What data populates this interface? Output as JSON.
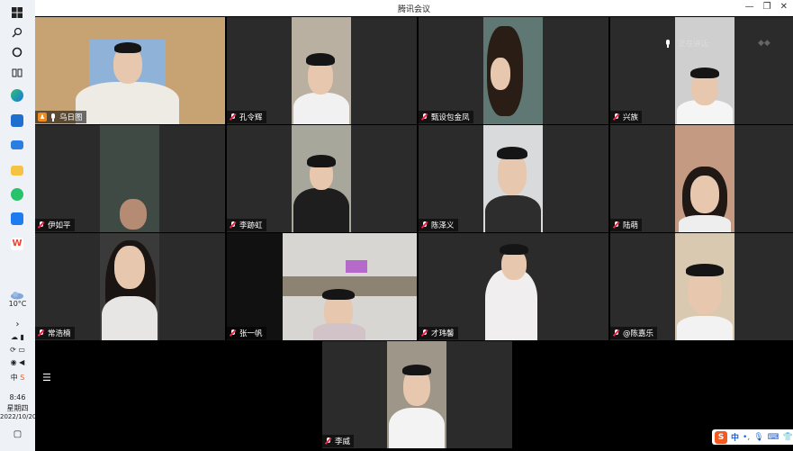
{
  "window": {
    "title": "腾讯会议"
  },
  "taskbar": {
    "weather": "10°C",
    "time": "8:46",
    "weekday": "星期四",
    "date": "2022/10/20"
  },
  "participants": [
    {
      "name": "乌日图",
      "mic": "on",
      "host": true
    },
    {
      "name": "孔令辉",
      "mic": "muted"
    },
    {
      "name": "甄设包金凤",
      "mic": "muted"
    },
    {
      "name": "兴族",
      "mic": "muted"
    },
    {
      "name": "伊如平",
      "mic": "muted"
    },
    {
      "name": "李跡虹",
      "mic": "muted"
    },
    {
      "name": "陈泽义",
      "mic": "muted"
    },
    {
      "name": "陆萌",
      "mic": "muted"
    },
    {
      "name": "常浩楠",
      "mic": "muted"
    },
    {
      "name": "张一帆",
      "mic": "muted"
    },
    {
      "name": "才玮馨",
      "mic": "muted"
    },
    {
      "name": "@陈嘉乐",
      "mic": "muted"
    },
    {
      "name": "李威",
      "mic": "muted"
    }
  ],
  "speaking_label": "正在讲话:",
  "ime": {
    "logo": "S",
    "mode": "中"
  },
  "colors": {
    "accent": "#f28b1e",
    "tile_bg": "#2b2b2b",
    "ime_red": "#f25a21"
  }
}
